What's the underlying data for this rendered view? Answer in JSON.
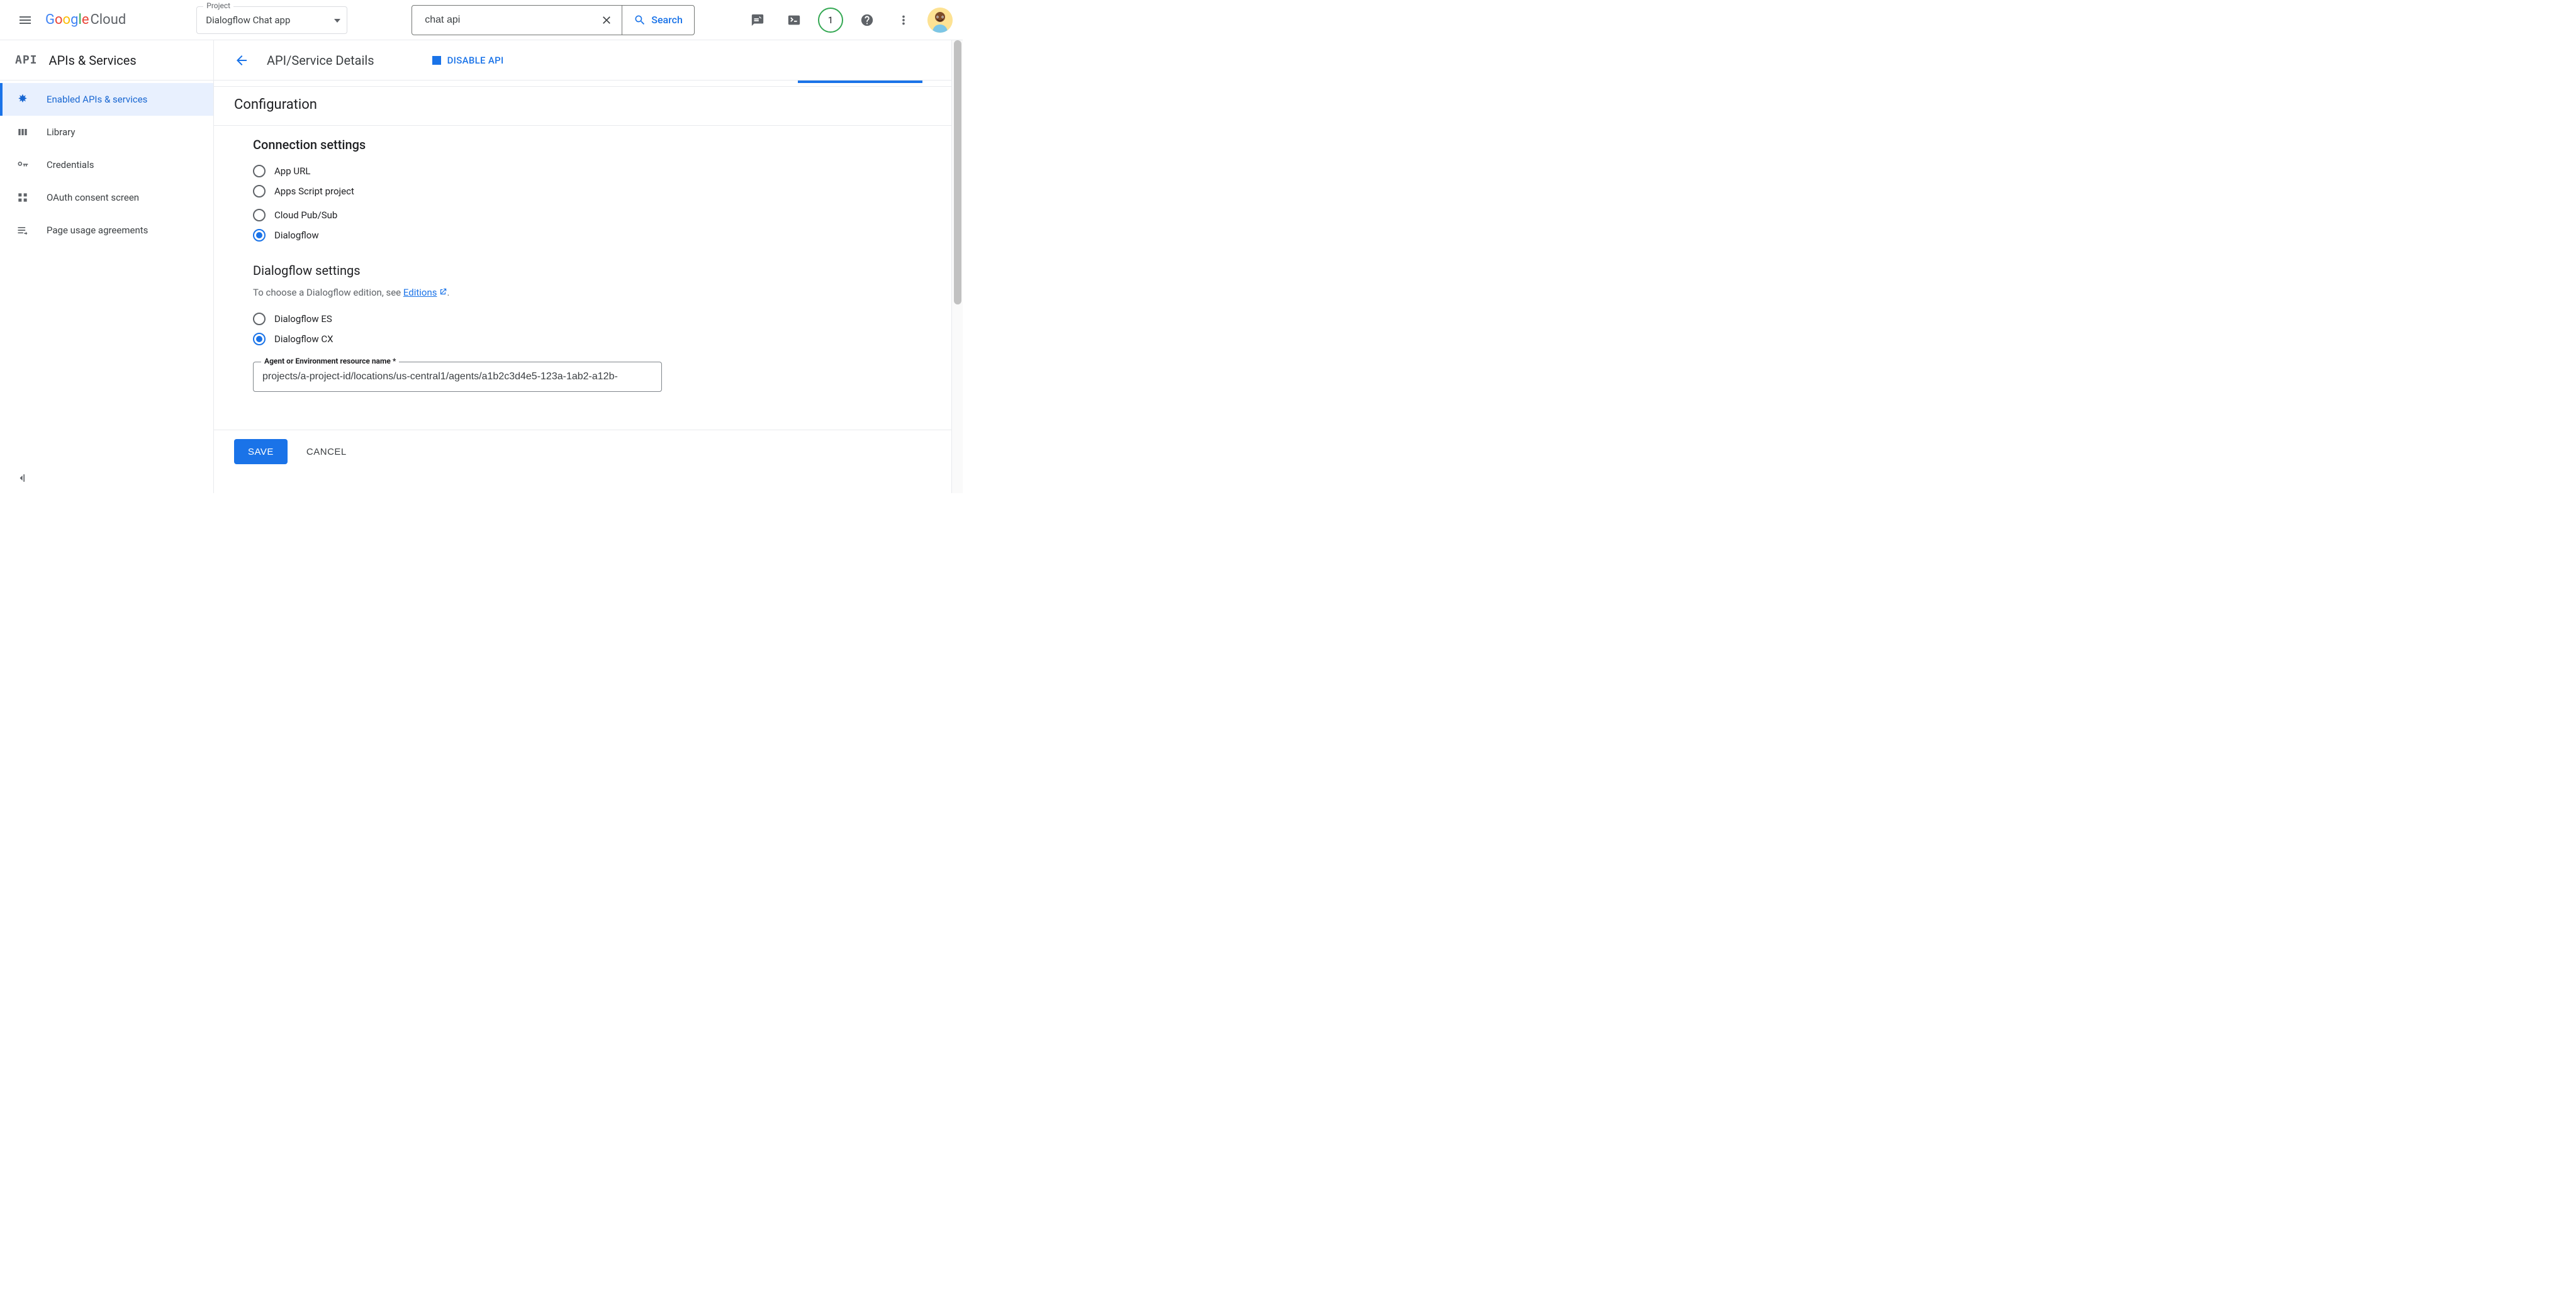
{
  "topbar": {
    "logo_text": "Cloud",
    "project_label": "Project",
    "project_value": "Dialogflow Chat app",
    "search_value": "chat api",
    "search_button": "Search",
    "notification_count": "1"
  },
  "sidebar": {
    "section_icon_text": "API",
    "section_title": "APIs & Services",
    "items": [
      {
        "label": "Enabled APIs & services",
        "active": true
      },
      {
        "label": "Library",
        "active": false
      },
      {
        "label": "Credentials",
        "active": false
      },
      {
        "label": "OAuth consent screen",
        "active": false
      },
      {
        "label": "Page usage agreements",
        "active": false
      }
    ]
  },
  "main": {
    "page_title": "API/Service Details",
    "disable_api_label": "DISABLE API",
    "config_heading": "Configuration",
    "connection": {
      "heading": "Connection settings",
      "options": [
        {
          "label": "App URL",
          "checked": false
        },
        {
          "label": "Apps Script project",
          "checked": false
        },
        {
          "label": "Cloud Pub/Sub",
          "checked": false
        },
        {
          "label": "Dialogflow",
          "checked": true
        }
      ]
    },
    "dialogflow": {
      "heading": "Dialogflow settings",
      "hint_prefix": "To choose a Dialogflow edition, see ",
      "hint_link": "Editions",
      "hint_suffix": ".",
      "editions": [
        {
          "label": "Dialogflow ES",
          "checked": false
        },
        {
          "label": "Dialogflow CX",
          "checked": true
        }
      ],
      "field_label": "Agent or Environment resource name *",
      "field_value": "projects/a-project-id/locations/us-central1/agents/a1b2c3d4e5-123a-1ab2-a12b-"
    },
    "footer": {
      "save": "SAVE",
      "cancel": "CANCEL"
    }
  }
}
